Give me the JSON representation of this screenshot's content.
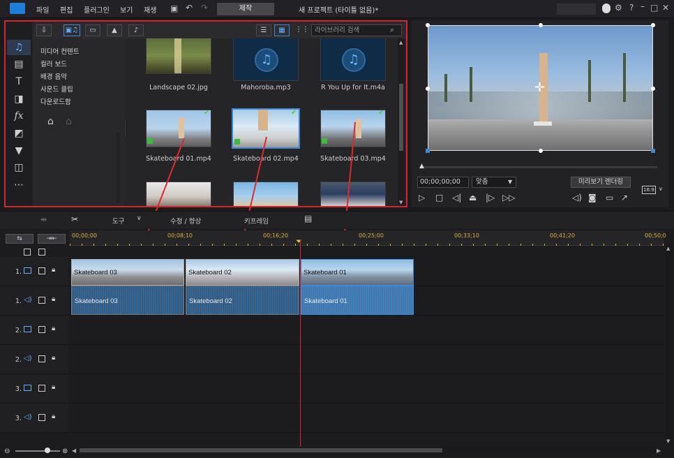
{
  "menu": [
    "파일",
    "편집",
    "플러그인",
    "보기",
    "재생"
  ],
  "produce_label": "제작",
  "project_title": "새 프로젝트 (타이틀 없음)*",
  "library": {
    "search_placeholder": "라이브러리 검색",
    "tree": [
      "미디어 컨텐트",
      "컬러 보드",
      "배경 음악",
      "사운드 클립",
      "다운로드함"
    ],
    "items": [
      {
        "name": "Landscape 02.jpg"
      },
      {
        "name": "Mahoroba.mp3"
      },
      {
        "name": "R You Up for It.m4a"
      },
      {
        "name": "Skateboard 01.mp4"
      },
      {
        "name": "Skateboard 02.mp4"
      },
      {
        "name": "Skateboard 03.mp4"
      }
    ]
  },
  "preview": {
    "timecode": "00;00;00;00",
    "fit_label": "맞춤",
    "render_label": "미리보기 렌더링",
    "aspect": "16:9"
  },
  "tools": {
    "tools_label": "도구",
    "fix_label": "수정 / 향상",
    "keyframe_label": "키프레임"
  },
  "ruler": [
    "00;00;00",
    "00;08;10",
    "00;16;20",
    "00;25;00",
    "00;33;10",
    "00;41;20",
    "00;50;0"
  ],
  "tracks": [
    "1.",
    "1.",
    "2.",
    "2.",
    "3.",
    "3."
  ],
  "clips": [
    {
      "video": "Skateboard 03",
      "audio": "Skateboard 03"
    },
    {
      "video": "Skateboard 02",
      "audio": "Skateboard 02"
    },
    {
      "video": "Skateboard 01",
      "audio": "Skateboard 01"
    }
  ],
  "colors": {
    "accent_blue": "#3f86d4",
    "highlight_red": "#d4262c",
    "playhead": "#d4262c"
  }
}
